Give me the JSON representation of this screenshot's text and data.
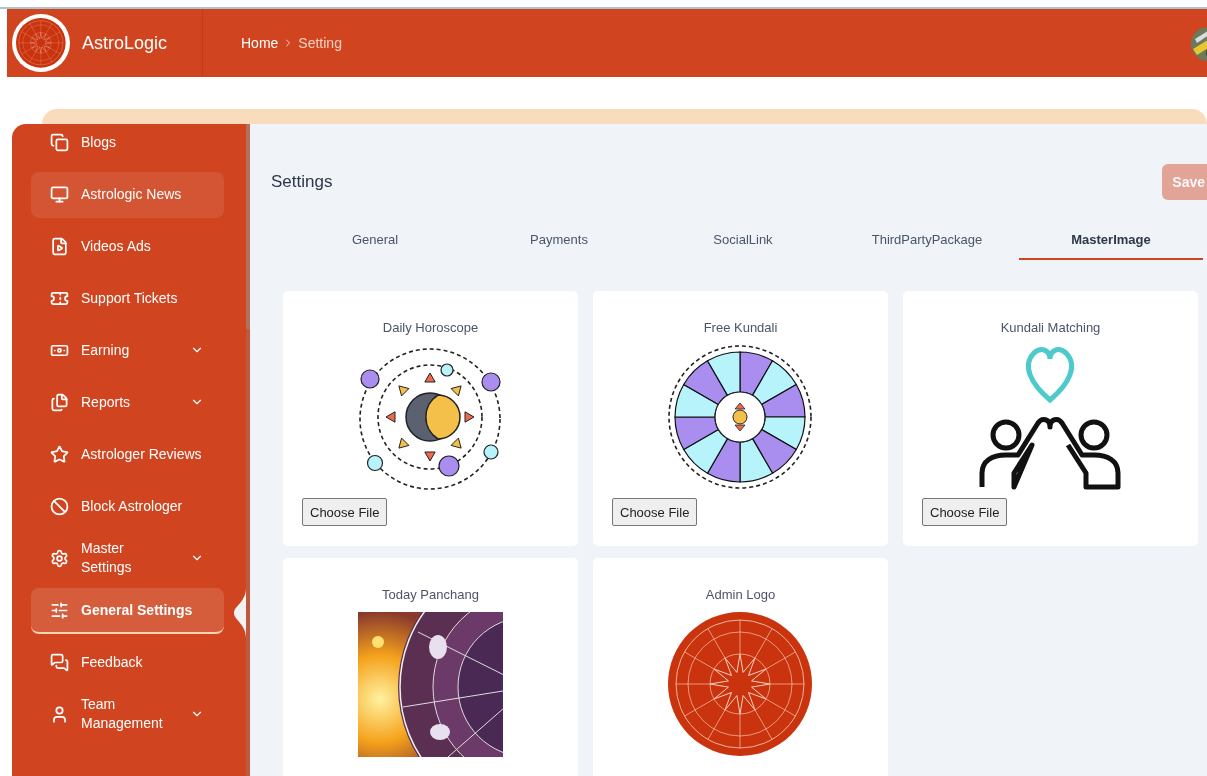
{
  "header": {
    "brand": "AstroLogic",
    "breadcrumb": [
      "Home",
      "Setting"
    ]
  },
  "sidebar": {
    "items": [
      {
        "label": "Blogs",
        "selected": false,
        "highlighted": false,
        "has_submenu": false
      },
      {
        "label": "Astrologic News",
        "selected": false,
        "highlighted": true,
        "has_submenu": false
      },
      {
        "label": "Videos Ads",
        "selected": false,
        "highlighted": false,
        "has_submenu": false
      },
      {
        "label": "Support Tickets",
        "selected": false,
        "highlighted": false,
        "has_submenu": false
      },
      {
        "label": "Earning",
        "selected": false,
        "highlighted": false,
        "has_submenu": true
      },
      {
        "label": "Reports",
        "selected": false,
        "highlighted": false,
        "has_submenu": true
      },
      {
        "label": "Astrologer Reviews",
        "selected": false,
        "highlighted": false,
        "has_submenu": false
      },
      {
        "label": "Block Astrologer",
        "selected": false,
        "highlighted": false,
        "has_submenu": false
      },
      {
        "label": "Master Settings",
        "selected": false,
        "highlighted": false,
        "has_submenu": true
      },
      {
        "label": "General Settings",
        "selected": true,
        "highlighted": false,
        "has_submenu": false
      },
      {
        "label": "Feedback",
        "selected": false,
        "highlighted": false,
        "has_submenu": false
      },
      {
        "label": "Team Management",
        "selected": false,
        "highlighted": false,
        "has_submenu": true
      }
    ]
  },
  "page": {
    "title": "Settings",
    "save_button": "Save",
    "save_disabled": true
  },
  "tabs": [
    {
      "label": "General",
      "selected": false
    },
    {
      "label": "Payments",
      "selected": false
    },
    {
      "label": "SocialLink",
      "selected": false
    },
    {
      "label": "ThirdPartyPackage",
      "selected": false
    },
    {
      "label": "MasterImage",
      "selected": true
    }
  ],
  "cards": [
    {
      "title": "Daily Horoscope",
      "kind": "sun-moon",
      "button": "Choose File"
    },
    {
      "title": "Free Kundali",
      "kind": "zodiac-wheel",
      "button": "Choose File"
    },
    {
      "title": "Kundali Matching",
      "kind": "heart-people",
      "button": "Choose File"
    },
    {
      "title": "Today Panchang",
      "kind": "picture"
    },
    {
      "title": "Admin Logo",
      "kind": "red-wheel"
    }
  ]
}
